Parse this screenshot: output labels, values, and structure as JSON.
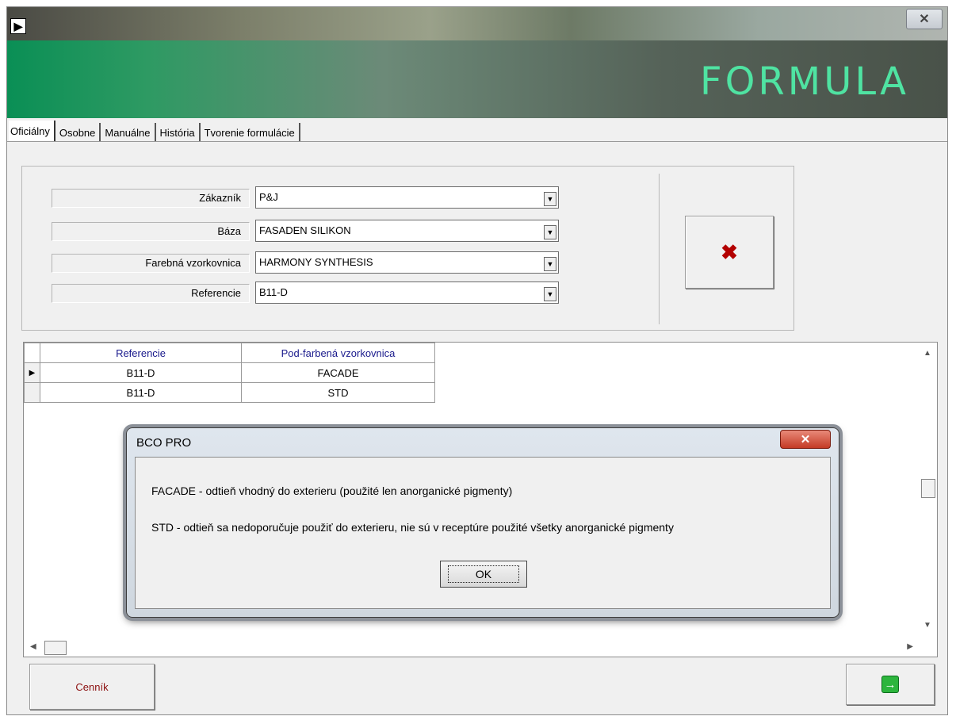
{
  "window": {
    "app_icon": "▶",
    "close_symbol": "✕"
  },
  "banner": {
    "title": "FORMULA"
  },
  "tabs": [
    {
      "label": "Oficiálny",
      "active": true
    },
    {
      "label": "Osobne"
    },
    {
      "label": "Manuálne"
    },
    {
      "label": "História"
    },
    {
      "label": "Tvorenie formulácie"
    }
  ],
  "filters": {
    "customer": {
      "label": "Zákazník",
      "value": "P&J"
    },
    "base": {
      "label": "Báza",
      "value": "FASADEN SILIKON"
    },
    "fandeck": {
      "label": "Farebná vzorkovnica",
      "value": "HARMONY SYNTHESIS"
    },
    "reference": {
      "label": "Referencie",
      "value": "B11-D"
    },
    "clear_icon": "✖"
  },
  "grid": {
    "columns": [
      "Referencie",
      "Pod-farbená vzorkovnica"
    ],
    "rows": [
      {
        "ref": "B11-D",
        "sub": "FACADE",
        "selected": true
      },
      {
        "ref": "B11-D",
        "sub": "STD"
      }
    ],
    "row_marker": "▶"
  },
  "dialog": {
    "title": "BCO PRO",
    "close_symbol": "✕",
    "line1": "FACADE - odtieň vhodný do exterieru (použité len anorganické pigmenty)",
    "line2": "STD - odtieň sa nedoporučuje použiť do exterieru, nie sú v receptúre použité všetky anorganické pigmenty",
    "ok_label": "OK"
  },
  "buttons": {
    "price_list": "Cenník",
    "next_icon": "→"
  },
  "colors": {
    "banner_title": "#4fe3a2",
    "clear_icon": "#b30000",
    "price_list_text": "#8c1010",
    "next_icon_bg": "#2db53d"
  }
}
